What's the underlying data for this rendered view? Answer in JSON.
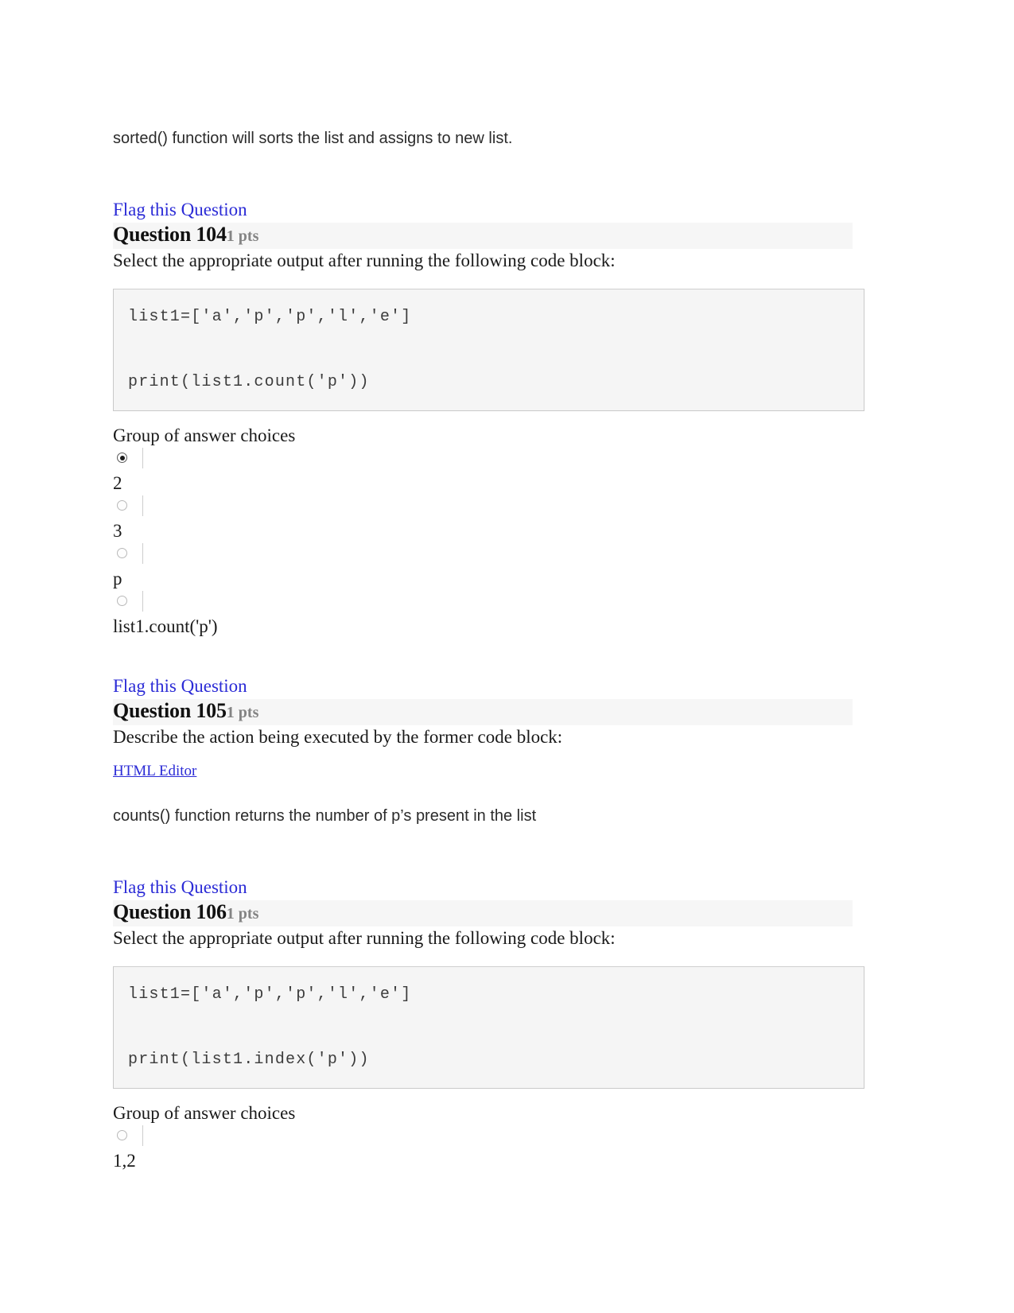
{
  "document": {
    "intro_note": "sorted() function will sorts the list and assigns to new list."
  },
  "questions": [
    {
      "flag_label": "Flag this Question",
      "title": "Question 104",
      "points": "1 pts",
      "prompt": "Select the appropriate output after running the following code block:",
      "code": {
        "line1": "list1=['a','p','p','l','e']",
        "line2": "print(list1.count('p'))"
      },
      "choices_label": "Group of answer choices",
      "choices": [
        {
          "text": "2",
          "selected": true
        },
        {
          "text": "3",
          "selected": false
        },
        {
          "text": "p",
          "selected": false
        },
        {
          "text": "list1.count('p')",
          "selected": false
        }
      ]
    },
    {
      "flag_label": "Flag this Question",
      "title": "Question 105",
      "points": "1 pts",
      "prompt": "Describe the action being executed by the former code block:",
      "editor_link": "HTML Editor",
      "answer_text": "counts() function returns the number of p’s present in the list"
    },
    {
      "flag_label": "Flag this Question",
      "title": "Question 106",
      "points": "1 pts",
      "prompt": "Select the appropriate output after running the following code block:",
      "code": {
        "line1": "list1=['a','p','p','l','e']",
        "line2": "print(list1.index('p'))"
      },
      "choices_label": "Group of answer choices",
      "choices": [
        {
          "text": "1,2",
          "selected": false
        }
      ]
    }
  ],
  "colors": {
    "link": "#2b2bd6",
    "header_bg": "#f6f6f6",
    "code_bg": "#f5f5f5",
    "code_border": "#c9c9c9",
    "points_text": "#848484",
    "body_text": "#1a1a1a"
  }
}
